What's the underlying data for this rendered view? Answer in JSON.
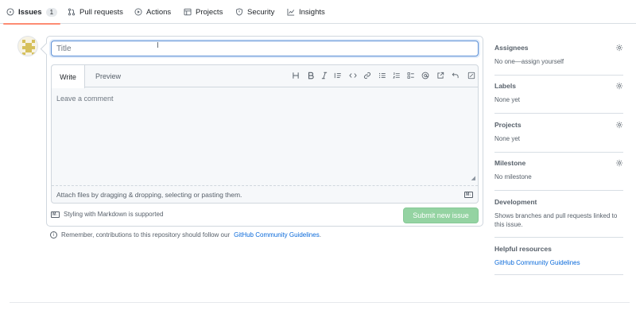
{
  "nav": {
    "tabs": [
      {
        "label": "Issues",
        "icon": "issue-opened-icon",
        "count": "1"
      },
      {
        "label": "Pull requests",
        "icon": "git-pull-request-icon"
      },
      {
        "label": "Actions",
        "icon": "play-icon"
      },
      {
        "label": "Projects",
        "icon": "table-icon"
      },
      {
        "label": "Security",
        "icon": "shield-icon"
      },
      {
        "label": "Insights",
        "icon": "graph-icon"
      }
    ]
  },
  "composer": {
    "title_placeholder": "Title",
    "write_tab": "Write",
    "preview_tab": "Preview",
    "toolbar": [
      "heading-icon",
      "bold-icon",
      "italic-icon",
      "quote-icon",
      "code-icon",
      "link-icon",
      "unordered-list-icon",
      "ordered-list-icon",
      "task-list-icon",
      "mention-icon",
      "reference-icon",
      "undo-icon",
      "fullscreen-icon"
    ],
    "comment_placeholder": "Leave a comment",
    "attach_text": "Attach files by dragging & dropping, selecting or pasting them.",
    "markdown_note": "Styling with Markdown is supported",
    "submit_label": "Submit new issue"
  },
  "remember": {
    "prefix": "Remember, contributions to this repository should follow our",
    "link": "GitHub Community Guidelines",
    "suffix": "."
  },
  "sidebar": {
    "assignees": {
      "heading": "Assignees",
      "value": "No one—assign yourself"
    },
    "labels": {
      "heading": "Labels",
      "value": "None yet"
    },
    "projects": {
      "heading": "Projects",
      "value": "None yet"
    },
    "milestone": {
      "heading": "Milestone",
      "value": "No milestone"
    },
    "development": {
      "heading": "Development",
      "value": "Shows branches and pull requests linked to this issue."
    },
    "helpful": {
      "heading": "Helpful resources",
      "value": "GitHub Community Guidelines"
    }
  },
  "colors": {
    "active_tab_underline": "#fd8c73",
    "submit_button": "#94d3a2",
    "link": "#0969da",
    "focus_border": "#5b8fd6"
  }
}
